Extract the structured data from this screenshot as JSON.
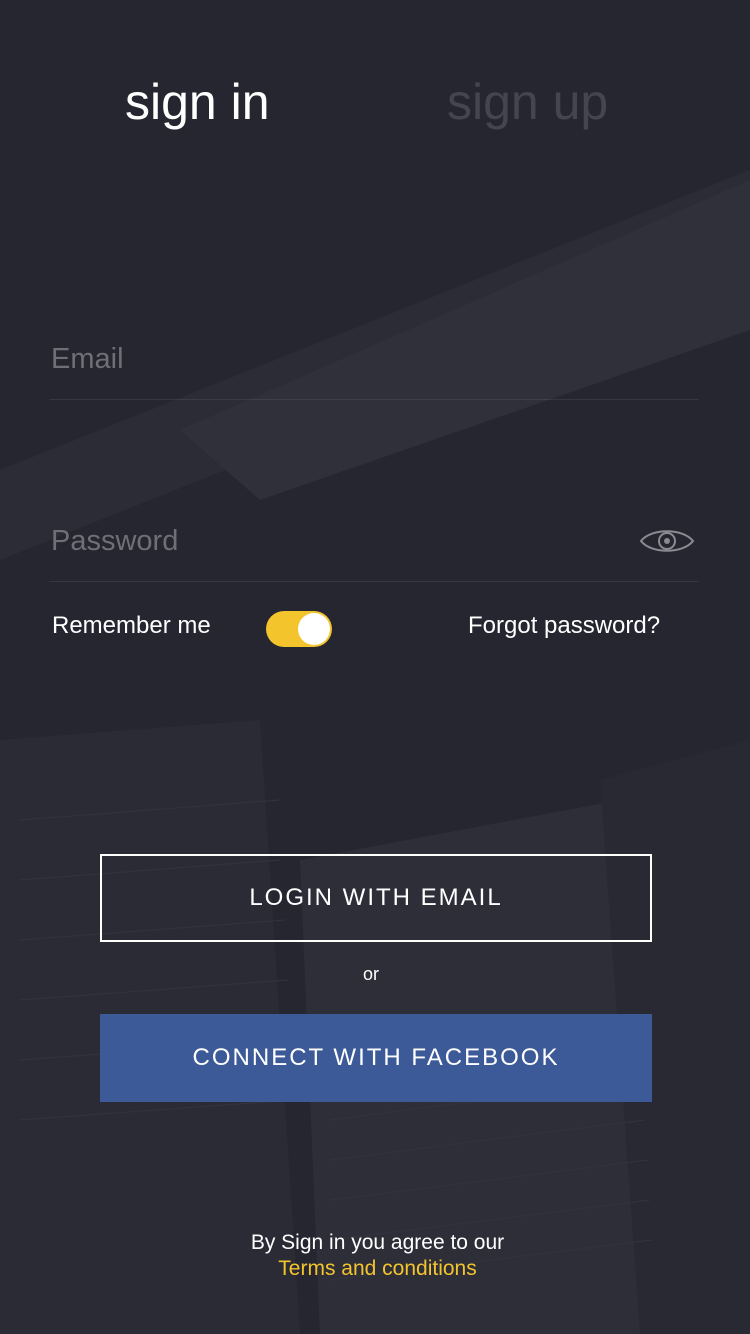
{
  "tabs": {
    "signin": "sign in",
    "signup": "sign up"
  },
  "form": {
    "email_placeholder": "Email",
    "password_placeholder": "Password",
    "remember_label": "Remember me",
    "remember_on": true,
    "forgot_label": "Forgot password?",
    "password_visibility_icon": "eye-icon"
  },
  "buttons": {
    "login_email": "LOGIN WITH EMAIL",
    "or_text": "or",
    "facebook": "CONNECT WITH FACEBOOK"
  },
  "footer": {
    "agree_text": "By Sign in you agree to our",
    "terms_link": "Terms and conditions"
  },
  "colors": {
    "background": "#262630",
    "accent": "#f3c42c",
    "facebook": "#3c5998",
    "inactive_tab": "#45454f"
  }
}
